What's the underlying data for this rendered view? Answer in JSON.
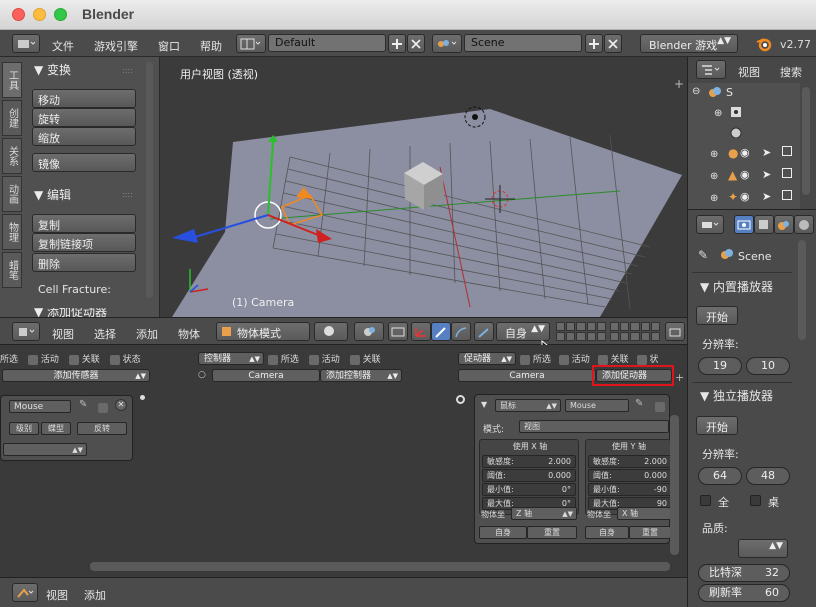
{
  "window": {
    "title": "Blender"
  },
  "topbar": {
    "menus": [
      "文件",
      "游戏引擎",
      "窗口",
      "帮助"
    ],
    "screen_layout": "Default",
    "scene": "Scene",
    "engine": "Blender 游戏",
    "version": "v2.77"
  },
  "tool_panel": {
    "tabs": [
      "工具",
      "创建",
      "关系",
      "动画",
      "物理",
      "蜡笔"
    ],
    "transform_header": "▼ 变换",
    "transform_buttons": [
      "移动",
      "旋转",
      "缩放"
    ],
    "mirror_button": "镜像",
    "edit_header": "▼ 编辑",
    "edit_buttons": [
      "复制",
      "复制链接项",
      "删除"
    ],
    "cell_fracture": "Cell Fracture:",
    "add_actuator_header": "▼ 添加促动器"
  },
  "viewport": {
    "view_label": "用户视图 (透视)",
    "object_label": "(1) Camera"
  },
  "viewport_header": {
    "menus": [
      "视图",
      "选择",
      "添加",
      "物体"
    ],
    "mode": "物体模式",
    "orientation": "自身"
  },
  "logic": {
    "sensors": {
      "flags": [
        "所选",
        "活动",
        "关联",
        "状态"
      ],
      "add": "添加传感器"
    },
    "controllers": {
      "type": "控制器",
      "flags": [
        "所选",
        "活动",
        "关联"
      ],
      "object": "Camera",
      "add": "添加控制器"
    },
    "actuators": {
      "type": "促动器",
      "flags": [
        "所选",
        "活动",
        "关联",
        "状"
      ],
      "object": "Camera",
      "add": "添加促动器"
    },
    "sensor_node": {
      "name": "Mouse",
      "buttons": [
        "级别",
        "蝶型",
        "反转"
      ]
    },
    "actuator_node": {
      "type": "鼠标",
      "name": "Mouse",
      "mode_label": "模式:",
      "mode_value": "视图",
      "x_axis": {
        "header": "使用 X 轴",
        "rows": [
          {
            "label": "敏感度:",
            "value": "2.000"
          },
          {
            "label": "阈值:",
            "value": "0.000"
          },
          {
            "label": "最小值:",
            "value": "0°"
          },
          {
            "label": "最大值:",
            "value": "0°"
          }
        ],
        "axis_label": "物体坐",
        "axis_value": "Z 轴",
        "local": "自身",
        "reset": "重置"
      },
      "y_axis": {
        "header": "使用 Y 轴",
        "rows": [
          {
            "label": "敏感度:",
            "value": "2.000"
          },
          {
            "label": "阈值:",
            "value": "0.000"
          },
          {
            "label": "最小值:",
            "value": "-90"
          },
          {
            "label": "最大值:",
            "value": "90"
          }
        ],
        "axis_label": "物体坐",
        "axis_value": "X 轴",
        "local": "自身",
        "reset": "重置"
      }
    }
  },
  "bottombar": {
    "menus": [
      "视图",
      "添加"
    ]
  },
  "outliner": {
    "menus": [
      "视图",
      "搜索"
    ],
    "root": "S"
  },
  "properties": {
    "scene_name": "Scene",
    "embedded_player": "▼ 内置播放器",
    "start1": "开始",
    "resolution_label1": "分辨率:",
    "res1": [
      "19",
      "10"
    ],
    "standalone_player": "▼ 独立播放器",
    "start2": "开始",
    "resolution_label2": "分辨率:",
    "res2": [
      "64",
      "48"
    ],
    "fullscreen": "全",
    "desktop": "桌",
    "quality_label": "品质:",
    "bitdepth_label": "比特深",
    "bitdepth_value": "32",
    "refresh_label": "刷新率",
    "refresh_value": "60"
  },
  "colors": {
    "highlight": "#e0141c",
    "accent_blue": "#5680c2"
  }
}
